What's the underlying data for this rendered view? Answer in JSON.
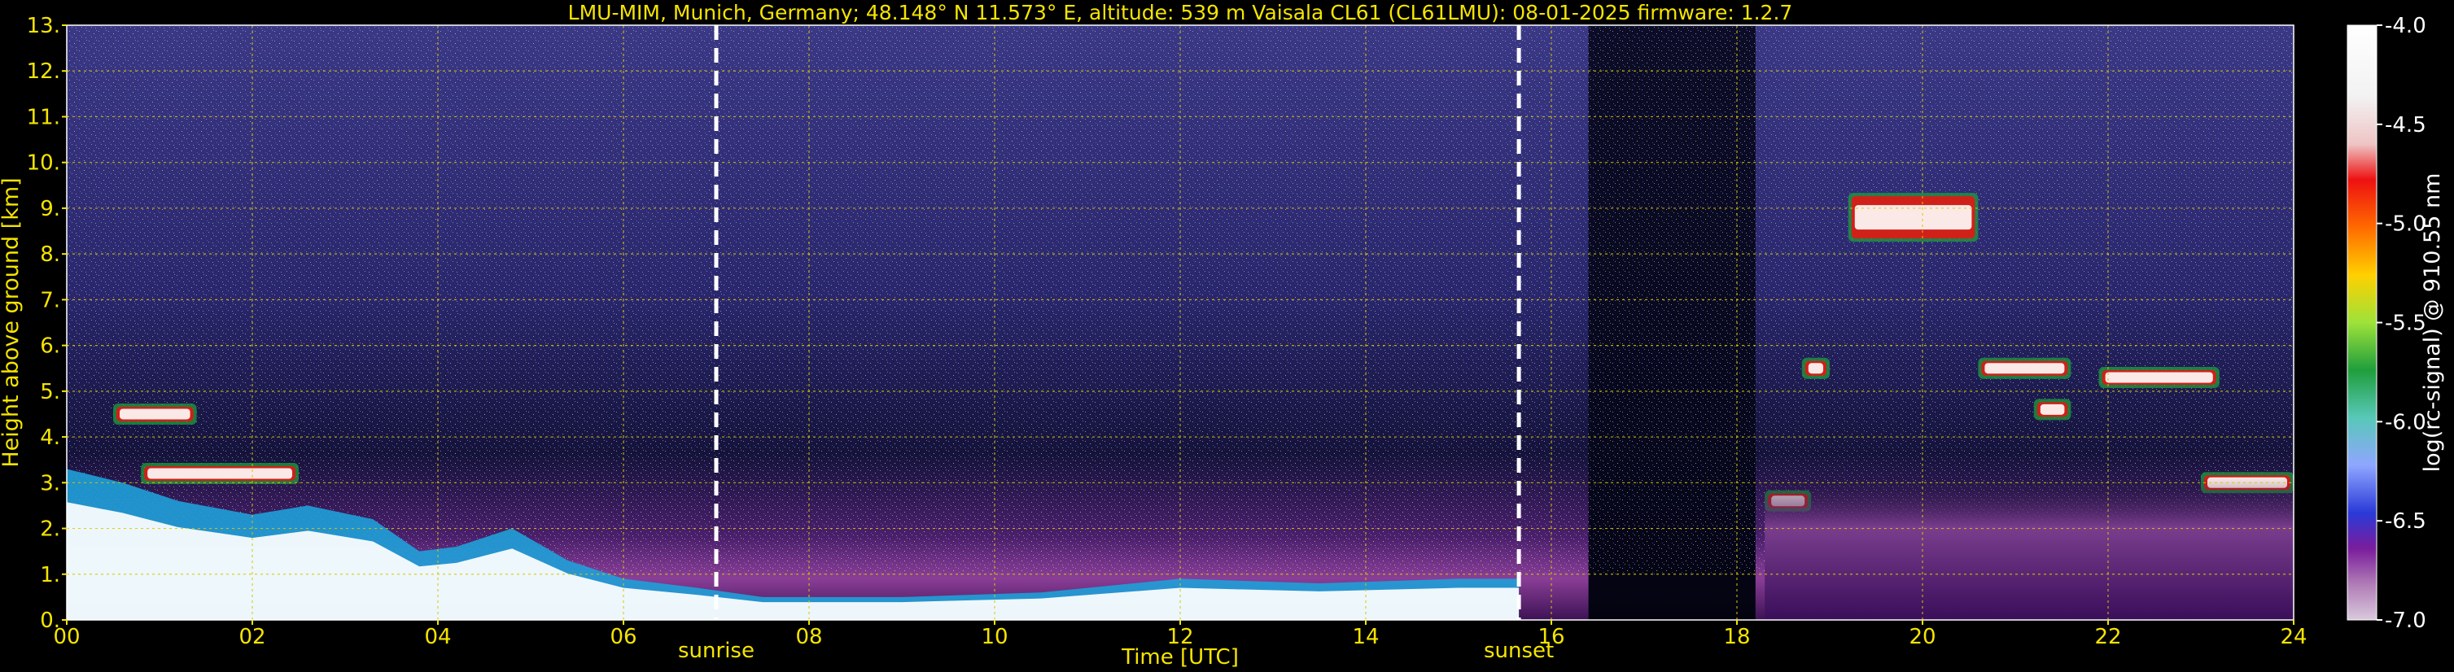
{
  "chart_data": {
    "type": "heatmap",
    "title": "LMU-MIM, Munich, Germany; 48.148° N 11.573° E, altitude: 539 m    Vaisala CL61 (CL61LMU): 08-01-2025    firmware: 1.2.7",
    "xlabel": "Time [UTC]",
    "ylabel": "Height above ground [km]",
    "xlim": [
      0,
      24
    ],
    "ylim": [
      0,
      13
    ],
    "xticks": [
      "00",
      "02",
      "04",
      "06",
      "08",
      "10",
      "12",
      "14",
      "16",
      "18",
      "20",
      "22",
      "24"
    ],
    "yticks": [
      "0.",
      "1.",
      "2.",
      "3.",
      "4.",
      "5.",
      "6.",
      "7.",
      "8.",
      "9.",
      "10.",
      "11.",
      "12.",
      "13."
    ],
    "grid": true,
    "annotations": [
      {
        "label": "sunrise",
        "x": 7.0
      },
      {
        "label": "sunset",
        "x": 15.65
      }
    ],
    "colorbar": {
      "label": "log(rc-signal) @ 910.55 nm",
      "range": [
        -7.0,
        -4.0
      ],
      "ticks": [
        "-4.0",
        "-4.5",
        "-5.0",
        "-5.5",
        "-6.0",
        "-6.5",
        "-7.0"
      ]
    },
    "features": {
      "aerosol_top_km": [
        [
          0.0,
          3.3
        ],
        [
          0.6,
          3.0
        ],
        [
          1.2,
          2.6
        ],
        [
          2.0,
          2.3
        ],
        [
          2.6,
          2.5
        ],
        [
          3.3,
          2.2
        ],
        [
          3.8,
          1.5
        ],
        [
          4.2,
          1.6
        ],
        [
          4.8,
          2.0
        ],
        [
          5.4,
          1.3
        ],
        [
          6.0,
          0.9
        ],
        [
          6.8,
          0.7
        ],
        [
          7.5,
          0.5
        ],
        [
          9.0,
          0.5
        ],
        [
          10.5,
          0.6
        ],
        [
          12.0,
          0.9
        ],
        [
          13.5,
          0.8
        ],
        [
          15.0,
          0.9
        ],
        [
          15.65,
          0.9
        ]
      ],
      "cloud_layers": [
        {
          "t0": 0.5,
          "t1": 1.4,
          "h": 4.5
        },
        {
          "t0": 0.8,
          "t1": 2.5,
          "h": 3.2
        },
        {
          "t0": 18.3,
          "t1": 18.8,
          "h": 2.6
        },
        {
          "t0": 18.7,
          "t1": 19.0,
          "h": 5.5
        },
        {
          "t0": 19.2,
          "t1": 20.6,
          "h": 8.8
        },
        {
          "t0": 20.6,
          "t1": 21.6,
          "h": 5.5
        },
        {
          "t0": 21.2,
          "t1": 21.6,
          "h": 4.6
        },
        {
          "t0": 21.9,
          "t1": 23.2,
          "h": 5.3
        },
        {
          "t0": 23.0,
          "t1": 24.0,
          "h": 3.0
        }
      ]
    }
  }
}
